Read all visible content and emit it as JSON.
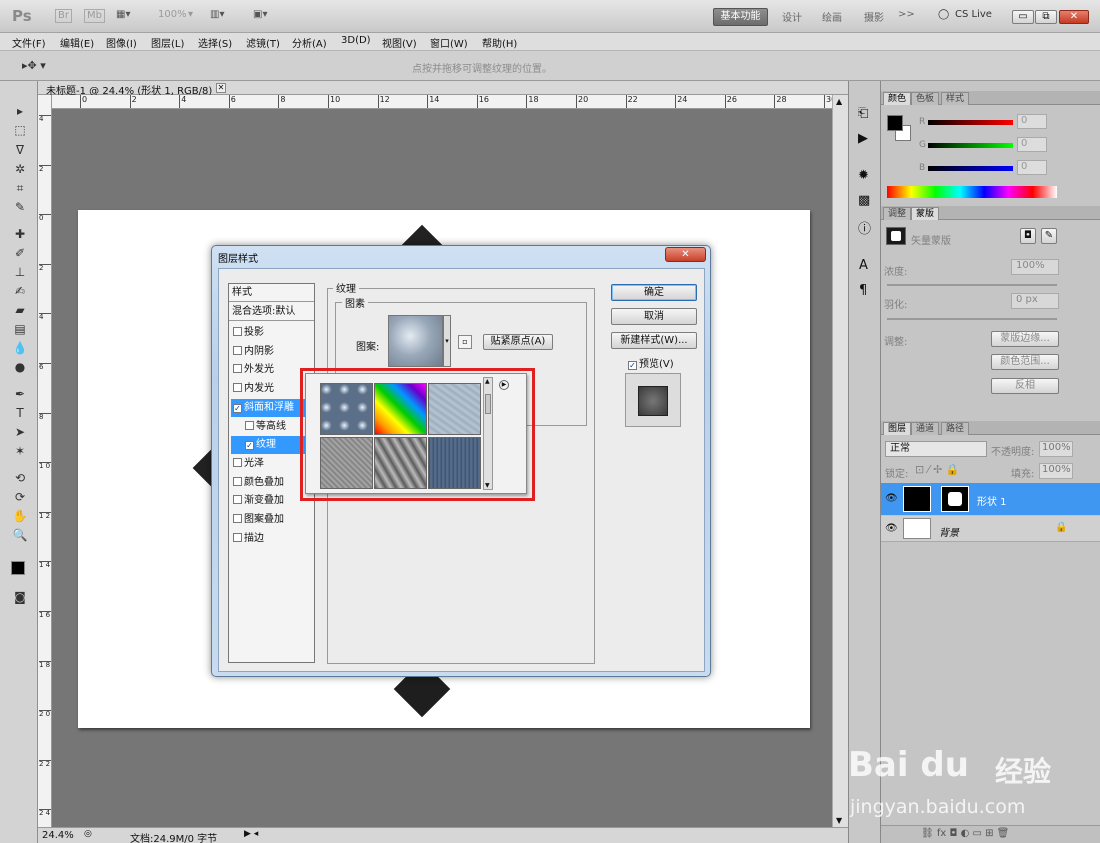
{
  "app": {
    "logo": "Ps",
    "zoom": "100%",
    "workspaces": [
      "基本功能",
      "设计",
      "绘画",
      "摄影"
    ],
    "more": ">>",
    "cslive": "CS Live"
  },
  "menu": [
    "文件(F)",
    "编辑(E)",
    "图像(I)",
    "图层(L)",
    "选择(S)",
    "滤镜(T)",
    "分析(A)",
    "3D(D)",
    "视图(V)",
    "窗口(W)",
    "帮助(H)"
  ],
  "options": {
    "hint": "点按并拖移可调整纹理的位置。"
  },
  "document": {
    "tab": "未标题-1 @ 24.4% (形状 1, RGB/8) *",
    "ruler_top": [
      "0",
      "2",
      "4",
      "6",
      "8",
      "10",
      "12",
      "14",
      "16",
      "18",
      "20",
      "22",
      "24",
      "26",
      "28",
      "30"
    ],
    "ruler_left": [
      "4",
      "2",
      "0",
      "2",
      "4",
      "6",
      "8",
      "1 0",
      "1 2",
      "1 4",
      "1 6",
      "1 8",
      "2 0",
      "2 2",
      "2 4"
    ]
  },
  "status": {
    "zoom": "24.4%",
    "doc": "文档:24.9M/0 字节"
  },
  "color_panel": {
    "tabs": [
      "颜色",
      "色板",
      "样式"
    ],
    "r_label": "R",
    "g_label": "G",
    "b_label": "B",
    "r": "0",
    "g": "0",
    "b": "0"
  },
  "adjust_panel": {
    "tabs": [
      "调整",
      "蒙版"
    ],
    "mask_label": "矢量蒙版",
    "density_label": "浓度:",
    "density": "100%",
    "feather_label": "羽化:",
    "feather": "0 px",
    "refine_label": "调整:",
    "btn_edge": "蒙版边缘...",
    "btn_range": "颜色范围...",
    "btn_invert": "反相"
  },
  "layers_panel": {
    "tabs": [
      "图层",
      "通道",
      "路径"
    ],
    "mode": "正常",
    "opacity_label": "不透明度:",
    "opacity": "100%",
    "lock_label": "锁定:",
    "fill_label": "填充:",
    "fill": "100%",
    "layers": [
      {
        "name": "形状 1"
      },
      {
        "name": "背景"
      }
    ]
  },
  "dialog": {
    "title": "图层样式",
    "styles_header": "样式",
    "blend": "混合选项:默认",
    "items": [
      {
        "label": "投影",
        "checked": false,
        "sub": false,
        "selected": false
      },
      {
        "label": "内阴影",
        "checked": false,
        "sub": false,
        "selected": false
      },
      {
        "label": "外发光",
        "checked": false,
        "sub": false,
        "selected": false
      },
      {
        "label": "内发光",
        "checked": false,
        "sub": false,
        "selected": false
      },
      {
        "label": "斜面和浮雕",
        "checked": true,
        "sub": false,
        "selected": true
      },
      {
        "label": "等高线",
        "checked": false,
        "sub": true,
        "selected": false
      },
      {
        "label": "纹理",
        "checked": true,
        "sub": true,
        "selected": true
      },
      {
        "label": "光泽",
        "checked": false,
        "sub": false,
        "selected": false
      },
      {
        "label": "颜色叠加",
        "checked": false,
        "sub": false,
        "selected": false
      },
      {
        "label": "渐变叠加",
        "checked": false,
        "sub": false,
        "selected": false
      },
      {
        "label": "图案叠加",
        "checked": false,
        "sub": false,
        "selected": false
      },
      {
        "label": "描边",
        "checked": false,
        "sub": false,
        "selected": false
      }
    ],
    "section": "纹理",
    "group": "图素",
    "pattern_label": "图案:",
    "snap_btn": "贴紧原点(A)",
    "ok": "确定",
    "cancel": "取消",
    "new_style": "新建样式(W)...",
    "preview": "预览(V)"
  },
  "watermark": {
    "brand": "Bai du",
    "cn": "经验",
    "url": "jingyan.baidu.com"
  }
}
